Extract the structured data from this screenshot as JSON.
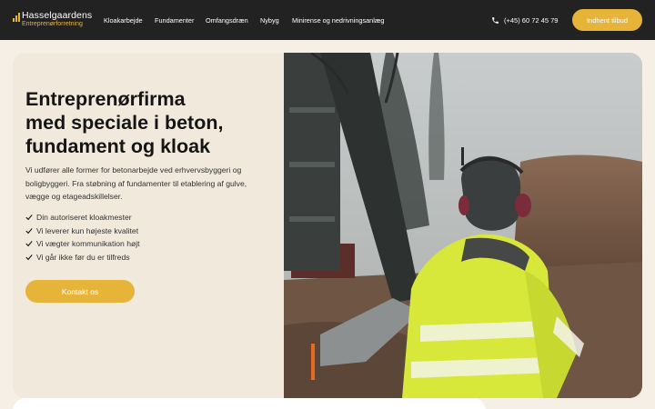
{
  "brand": {
    "name": "Hasselgaardens",
    "tagline": "Entreprenørforretning",
    "accent": "#e7b43a",
    "dark": "#222222"
  },
  "nav": {
    "items": [
      {
        "label": "Kloakarbejde"
      },
      {
        "label": "Fundamenter"
      },
      {
        "label": "Omfangsdræn"
      },
      {
        "label": "Nybyg"
      },
      {
        "label": "Minirense og nedrivningsanlæg"
      }
    ],
    "phone": "(+45)  60 72 45 79",
    "phone_icon": "phone-icon",
    "cta": "Indhent tilbud"
  },
  "hero": {
    "title_lines": [
      "Entreprenørfirma",
      "med speciale i beton,",
      "fundament og kloak"
    ],
    "description": "Vi udfører alle former for betonarbejde ved erhvervsbyggeri og boligbyggeri. Fra støbning af fundamenter til etablering af gulve, vægge og etageadskillelser.",
    "checks": [
      "Din autoriseret kloakmester",
      "Vi leverer kun højeste kvalitet",
      "Vi vægter kommunikation højt",
      "Vi går ikke før du er tilfreds"
    ],
    "check_icon": "check-icon",
    "cta": "Kontakt os"
  }
}
